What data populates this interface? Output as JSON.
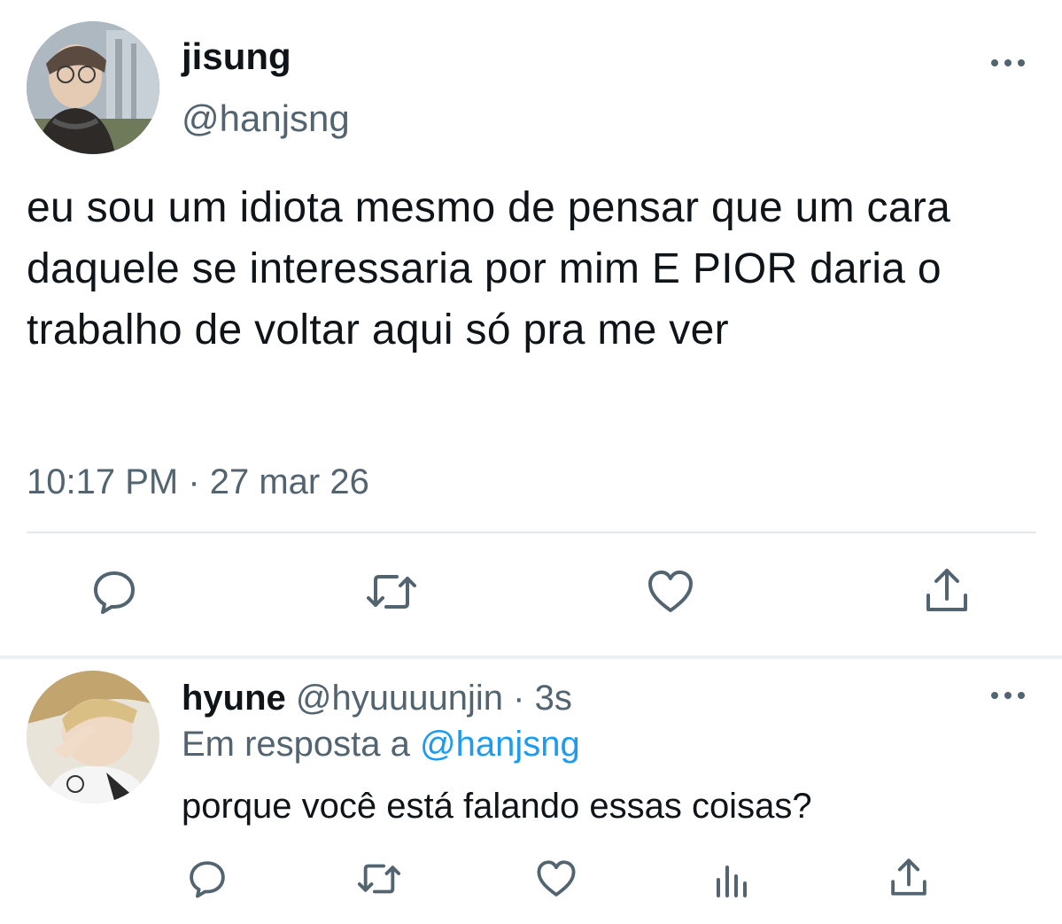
{
  "main_tweet": {
    "display_name": "jisung",
    "handle": "@hanjsng",
    "text": "eu sou um idiota mesmo de pensar que um cara daquele se interessaria por mim E PIOR daria o trabalho de voltar aqui só pra me ver",
    "timestamp": "10:17 PM · 27 mar 26",
    "actions": {
      "reply_icon": "speech-bubble-icon",
      "retweet_icon": "retweet-icon",
      "like_icon": "heart-icon",
      "share_icon": "share-icon"
    }
  },
  "reply": {
    "display_name": "hyune",
    "handle_meta": "@hyuuuunjin · 3s",
    "replying_to_prefix": "Em resposta a",
    "replying_to_handle": "@hanjsng",
    "text": "porque você está falando essas coisas?",
    "actions": {
      "reply_icon": "speech-bubble-icon",
      "retweet_icon": "retweet-icon",
      "like_icon": "heart-icon",
      "analytics_icon": "bar-chart-icon",
      "share_icon": "share-icon"
    }
  },
  "colors": {
    "text": "#0f1419",
    "secondary": "#536471",
    "link": "#1d9bf0",
    "icon": "#536471",
    "divider": "#e4e7ea"
  }
}
